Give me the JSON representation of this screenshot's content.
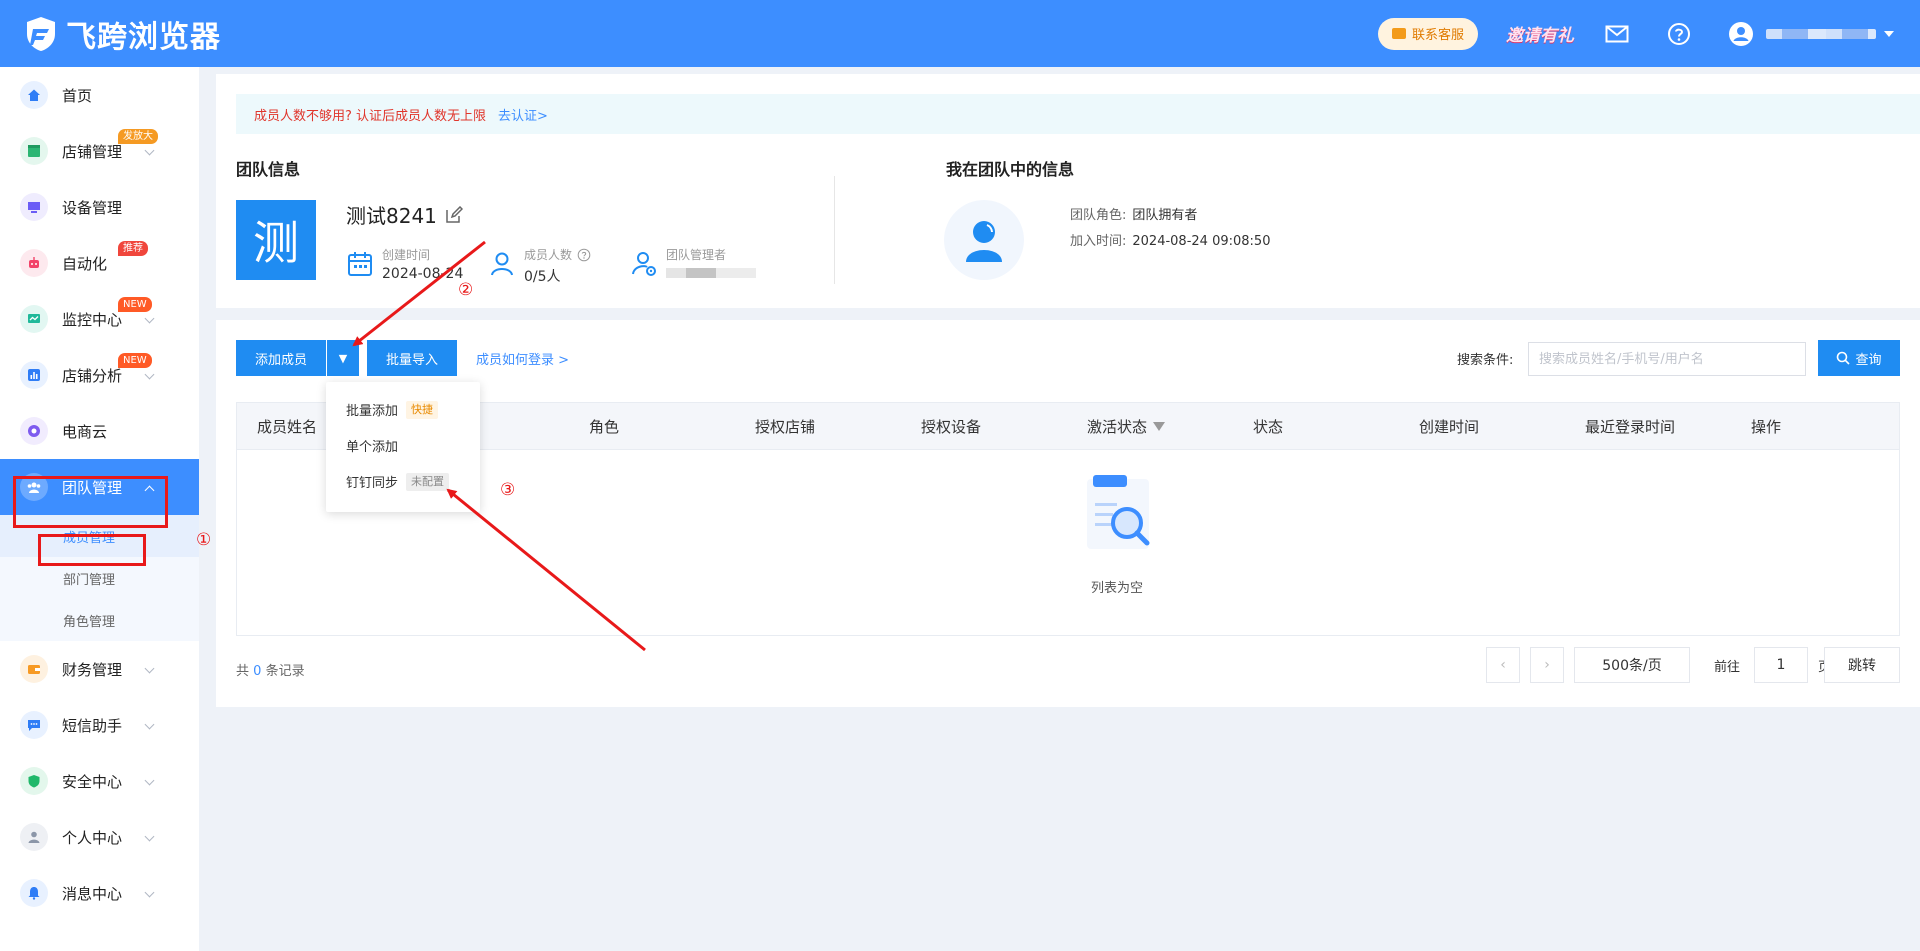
{
  "header": {
    "app_name": "飞跨浏览器",
    "service_label": "联系客服",
    "invite_label": "邀请有礼",
    "icons": [
      "mail-icon",
      "help-icon",
      "user-icon"
    ]
  },
  "sidebar": {
    "items": [
      {
        "label": "首页",
        "icon": "home-icon",
        "color": "#2f7df6"
      },
      {
        "label": "店铺管理",
        "icon": "store-icon",
        "color": "#2bb673",
        "badge": "发放大",
        "badge_color": "#f59a23"
      },
      {
        "label": "设备管理",
        "icon": "device-icon",
        "color": "#6b5cf6"
      },
      {
        "label": "自动化",
        "icon": "robot-icon",
        "color": "#f2446a",
        "badge": "推荐",
        "badge_color": "#f0463c"
      },
      {
        "label": "监控中心",
        "icon": "monitor-icon",
        "color": "#1fb99a",
        "badge": "NEW",
        "badge_color": "#ff5a26"
      },
      {
        "label": "店铺分析",
        "icon": "analysis-icon",
        "color": "#2f7df6",
        "badge": "NEW",
        "badge_color": "#ff5a26"
      },
      {
        "label": "电商云",
        "icon": "cloud-icon",
        "color": "#7e5bef"
      },
      {
        "label": "团队管理",
        "icon": "team-icon",
        "color": "#ffffff"
      },
      {
        "label": "财务管理",
        "icon": "wallet-icon",
        "color": "#f79a24"
      },
      {
        "label": "短信助手",
        "icon": "sms-icon",
        "color": "#2f7df6"
      },
      {
        "label": "安全中心",
        "icon": "shield-icon",
        "color": "#20b86a"
      },
      {
        "label": "个人中心",
        "icon": "person-icon",
        "color": "#8b96a8"
      },
      {
        "label": "消息中心",
        "icon": "bell-icon",
        "color": "#2f7df6"
      }
    ],
    "sub_items": [
      "成员管理",
      "部门管理",
      "角色管理"
    ]
  },
  "notice": {
    "text": "成员人数不够用? 认证后成员人数无上限",
    "link": "去认证>"
  },
  "team": {
    "section_title": "团队信息",
    "avatar_char": "测",
    "name": "测试8241",
    "created_label": "创建时间",
    "created_value": "2024-08-24",
    "members_label": "成员人数",
    "members_value": "0/5人",
    "admin_label": "团队管理者"
  },
  "me": {
    "section_title": "我在团队中的信息",
    "role_label": "团队角色:",
    "role_value": "团队拥有者",
    "join_label": "加入时间:",
    "join_value": "2024-08-24 09:08:50"
  },
  "toolbar": {
    "add_member": "添加成员",
    "dropdown_caret": "▼",
    "bulk_import": "批量导入",
    "login_help": "成员如何登录 >",
    "search_label": "搜索条件:",
    "search_placeholder": "搜索成员姓名/手机号/用户名",
    "query": "查询"
  },
  "dropdown": {
    "items": [
      {
        "label": "批量添加",
        "tag": "快捷"
      },
      {
        "label": "单个添加"
      },
      {
        "label": "钉钉同步",
        "tag": "未配置"
      }
    ]
  },
  "table": {
    "columns": [
      "成员姓名",
      "角色",
      "授权店铺",
      "授权设备",
      "激活状态",
      "状态",
      "创建时间",
      "最近登录时间",
      "操作"
    ],
    "empty_text": "列表为空"
  },
  "pagination": {
    "total_prefix": "共",
    "total_count": "0",
    "total_suffix": "条记录",
    "prev": "‹",
    "next": "›",
    "page_size": "500条/页",
    "goto_label": "前往",
    "page_value": "1",
    "page_unit": "页",
    "jump": "跳转"
  },
  "annotations": [
    "①",
    "②",
    "③"
  ],
  "colors": {
    "primary": "#3d8eff",
    "button": "#1f8cf2",
    "annotation": "#e8191a"
  }
}
